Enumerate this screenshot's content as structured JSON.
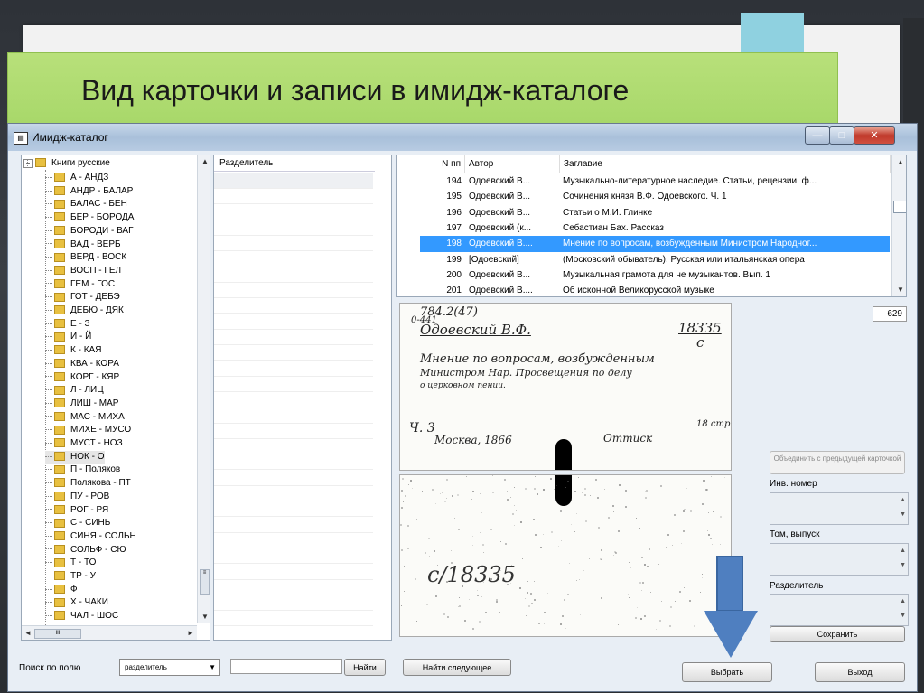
{
  "slide": {
    "title": "Вид карточки и записи в имидж-каталоге"
  },
  "window": {
    "title": "Имидж-каталог",
    "controls": {
      "minimize": "—",
      "maximize": "□",
      "close": "✕"
    }
  },
  "tree": {
    "root": "Книги русские",
    "items": [
      "А - АНДЗ",
      "АНДР - БАЛАР",
      "БАЛАС - БЕН",
      "БЕР - БОРОДА",
      "БОРОДИ - ВАГ",
      "ВАД - ВЕРБ",
      "ВЕРД - ВОСК",
      "ВОСП - ГЕЛ",
      "ГЕМ - ГОС",
      "ГОТ - ДЕБЭ",
      "ДЕБЮ - ДЯК",
      "Е - З",
      "И - Й",
      "К - КАЯ",
      "КВА - КОРА",
      "КОРГ - КЯР",
      "Л - ЛИЦ",
      "ЛИШ - МАР",
      "МАС - МИХА",
      "МИХЕ - МУСО",
      "МУСТ - НОЗ",
      "НОК - О",
      "П - Поляков",
      "Полякова - ПТ",
      "ПУ - РОВ",
      "РОГ - РЯ",
      "С - СИНЬ",
      "СИНЯ - СОЛЬН",
      "СОЛЬФ - СЮ",
      "Т - ТО",
      "ТР - У",
      "Ф",
      "Х - ЧАКИ",
      "ЧАЛ - ШОС"
    ],
    "selected": "НОК - О",
    "hscroll_label": "III"
  },
  "separator_panel": {
    "header": "Разделитель"
  },
  "list": {
    "columns": {
      "num": "N пп",
      "author": "Автор",
      "title": "Заглавие"
    },
    "rows": [
      {
        "num": "194",
        "author": "Одоевский В...",
        "title": "Музыкально-литературное наследие. Статьи, рецензии, ф..."
      },
      {
        "num": "195",
        "author": "Одоевский В...",
        "title": "Сочинения князя В.Ф. Одоевского. Ч. 1"
      },
      {
        "num": "196",
        "author": "Одоевский В...",
        "title": "Статьи о М.И. Глинке"
      },
      {
        "num": "197",
        "author": "Одоевский (к...",
        "title": "Себастиан Бах. Рассказ"
      },
      {
        "num": "198",
        "author": "Одоевский В....",
        "title": "Мнение по вопросам, возбужденным Министром Народног..."
      },
      {
        "num": "199",
        "author": "[Одоевский]",
        "title": "(Московский обыватель). Русская или итальянская опера"
      },
      {
        "num": "200",
        "author": "Одоевский В...",
        "title": "Музыкальная грамота для не музыкантов. Вып. 1"
      },
      {
        "num": "201",
        "author": "Одоевский В....",
        "title": "Об исконной Великорусской музыке"
      }
    ],
    "selected_num": "198"
  },
  "card": {
    "shelf_mark": "784.2(47)",
    "sub_mark": "0-441",
    "author_line": "Одоевский В.Ф.",
    "inv": "18335",
    "inv_letter": "с",
    "text_line1": "Мнение по вопросам, возбужденным",
    "text_line2": "Министром Нар. Просвещения по делу",
    "text_line3": "о церковном пении.",
    "part": "Ч. 3",
    "pages": "18 стр.",
    "imprint": "Москва, 1866",
    "note": "Оттиск",
    "back_mark": "с/18335"
  },
  "right_panel": {
    "count": "629",
    "combine_button": "Объединить с предыдущей карточкой",
    "inv_label": "Инв. номер",
    "volume_label": "Том, выпуск",
    "separator_label": "Разделитель",
    "save_button": "Сохранить"
  },
  "bottom_bar": {
    "search_label": "Поиск по полю",
    "field_select": "разделитель",
    "search_value": "",
    "find_button": "Найти",
    "find_next_button": "Найти следующее",
    "choose_button": "Выбрать",
    "exit_button": "Выход"
  },
  "colors": {
    "title_bar_green": "#b8e07a",
    "selection_blue": "#3399ff",
    "arrow_blue": "#4f7fc0"
  }
}
